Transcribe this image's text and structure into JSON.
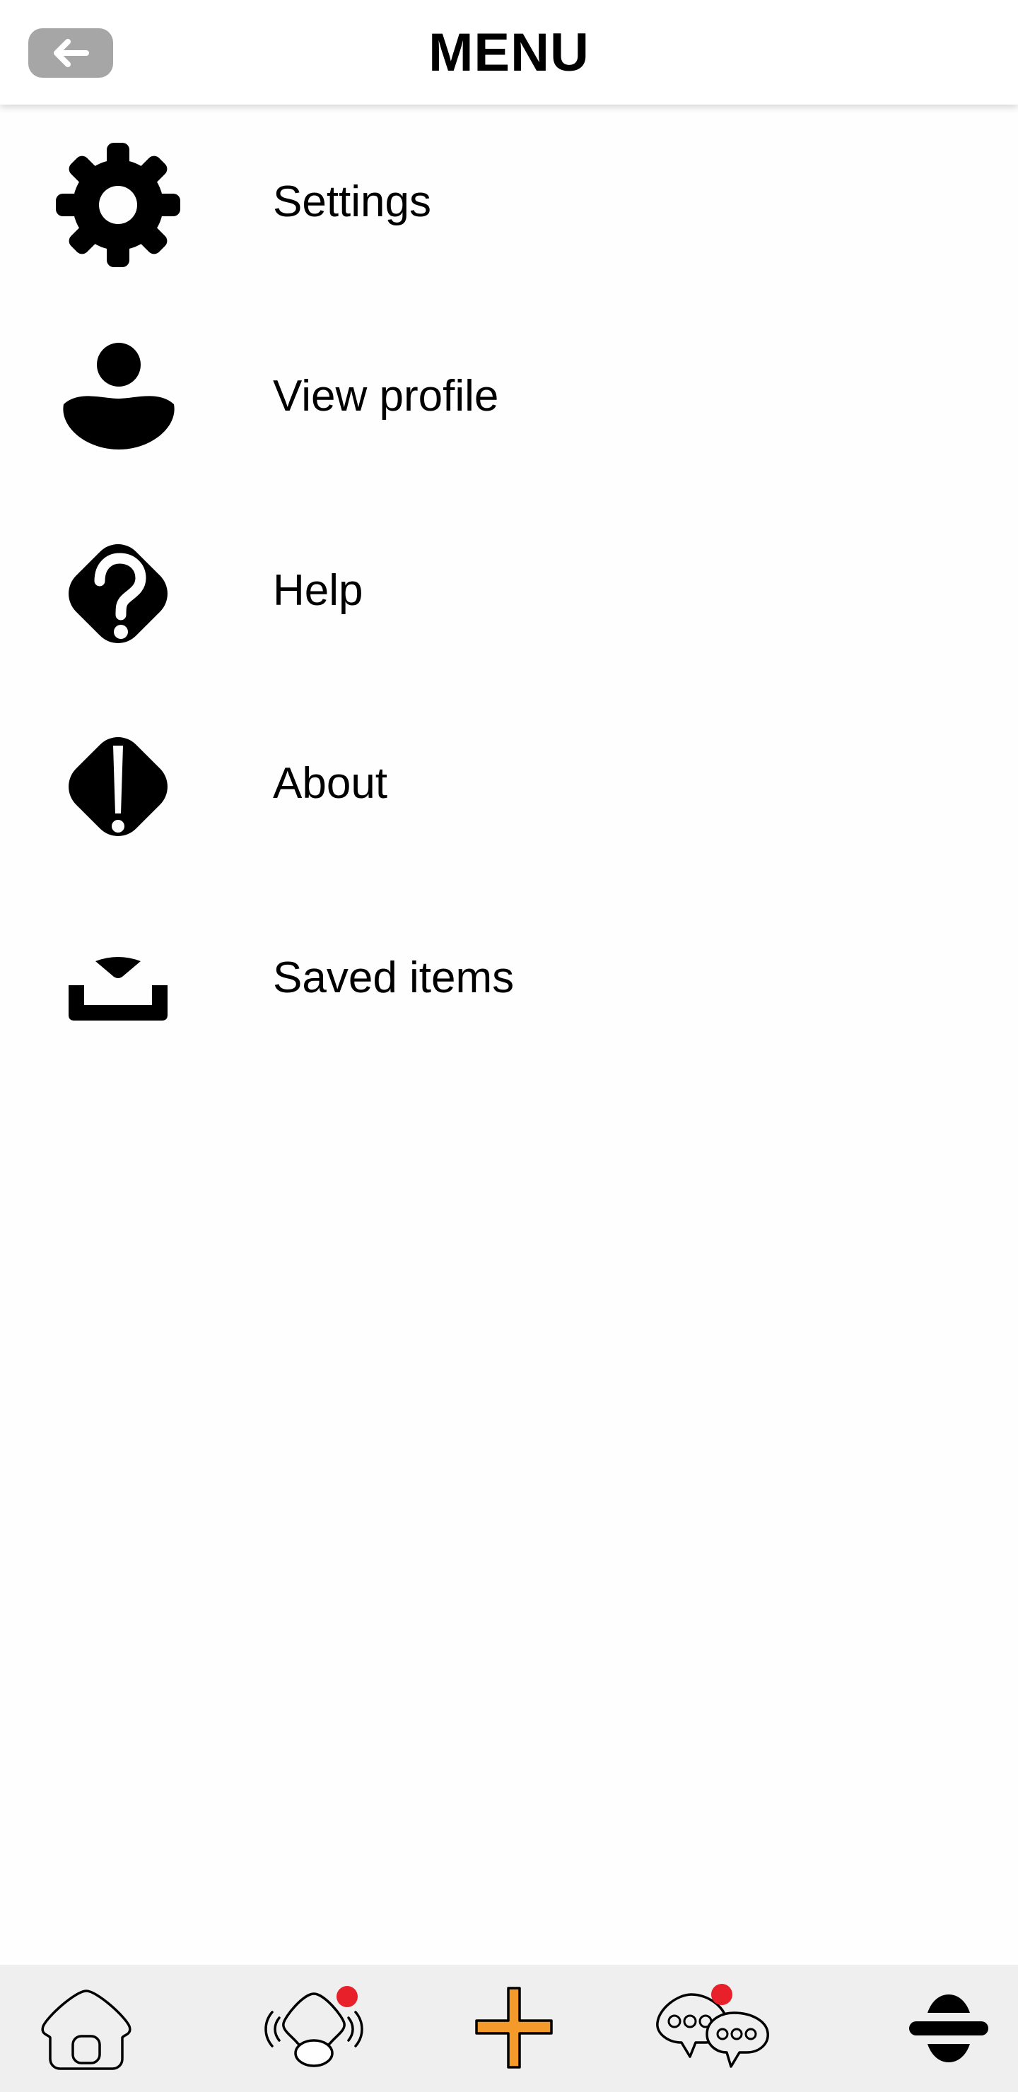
{
  "header": {
    "title": "MENU",
    "back_icon": "arrow-left-icon"
  },
  "menu": {
    "items": [
      {
        "label": "Settings",
        "icon": "gear-icon"
      },
      {
        "label": "View profile",
        "icon": "profile-icon"
      },
      {
        "label": "Help",
        "icon": "question-icon"
      },
      {
        "label": "About",
        "icon": "exclamation-icon"
      },
      {
        "label": "Saved items",
        "icon": "tray-icon"
      }
    ]
  },
  "bottom_nav": {
    "items": [
      {
        "icon": "home-icon",
        "has_notification": false
      },
      {
        "icon": "broadcast-icon",
        "has_notification": true
      },
      {
        "icon": "plus-icon",
        "has_notification": false
      },
      {
        "icon": "chat-bubbles-icon",
        "has_notification": true
      },
      {
        "icon": "menu-icon",
        "has_notification": false,
        "active": true
      }
    ]
  },
  "colors": {
    "accent": "#f39a2b",
    "notification": "#e8202a",
    "header_button": "#a6a6a6",
    "nav_background": "#efefef"
  }
}
